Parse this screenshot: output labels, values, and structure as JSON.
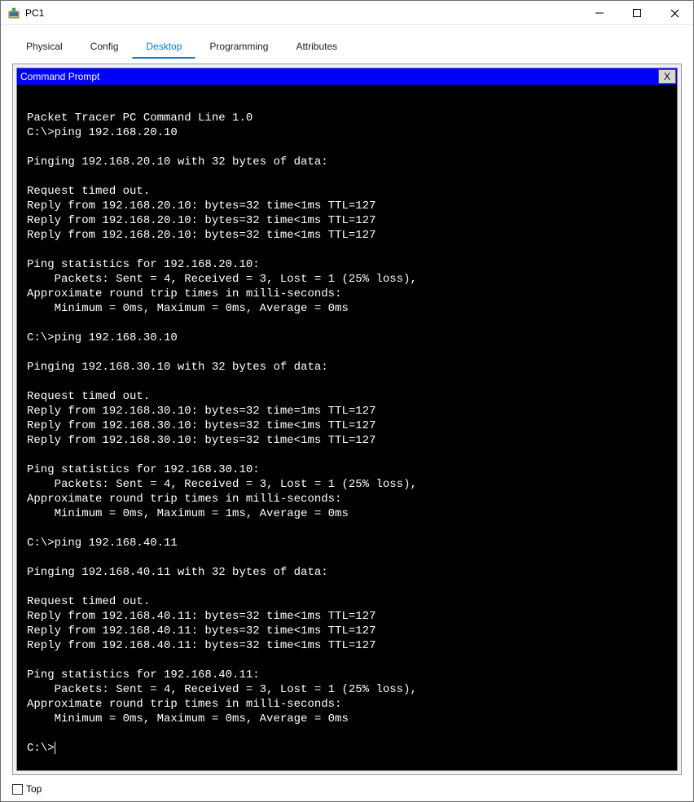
{
  "window": {
    "title": "PC1"
  },
  "tabs": {
    "items": [
      {
        "label": "Physical",
        "active": false
      },
      {
        "label": "Config",
        "active": false
      },
      {
        "label": "Desktop",
        "active": true
      },
      {
        "label": "Programming",
        "active": false
      },
      {
        "label": "Attributes",
        "active": false
      }
    ]
  },
  "cmd": {
    "title": "Command Prompt",
    "close_label": "X"
  },
  "terminal": {
    "lines": [
      "",
      "Packet Tracer PC Command Line 1.0",
      "C:\\>ping 192.168.20.10",
      "",
      "Pinging 192.168.20.10 with 32 bytes of data:",
      "",
      "Request timed out.",
      "Reply from 192.168.20.10: bytes=32 time<1ms TTL=127",
      "Reply from 192.168.20.10: bytes=32 time<1ms TTL=127",
      "Reply from 192.168.20.10: bytes=32 time<1ms TTL=127",
      "",
      "Ping statistics for 192.168.20.10:",
      "    Packets: Sent = 4, Received = 3, Lost = 1 (25% loss),",
      "Approximate round trip times in milli-seconds:",
      "    Minimum = 0ms, Maximum = 0ms, Average = 0ms",
      "",
      "C:\\>ping 192.168.30.10",
      "",
      "Pinging 192.168.30.10 with 32 bytes of data:",
      "",
      "Request timed out.",
      "Reply from 192.168.30.10: bytes=32 time=1ms TTL=127",
      "Reply from 192.168.30.10: bytes=32 time<1ms TTL=127",
      "Reply from 192.168.30.10: bytes=32 time<1ms TTL=127",
      "",
      "Ping statistics for 192.168.30.10:",
      "    Packets: Sent = 4, Received = 3, Lost = 1 (25% loss),",
      "Approximate round trip times in milli-seconds:",
      "    Minimum = 0ms, Maximum = 1ms, Average = 0ms",
      "",
      "C:\\>ping 192.168.40.11",
      "",
      "Pinging 192.168.40.11 with 32 bytes of data:",
      "",
      "Request timed out.",
      "Reply from 192.168.40.11: bytes=32 time<1ms TTL=127",
      "Reply from 192.168.40.11: bytes=32 time<1ms TTL=127",
      "Reply from 192.168.40.11: bytes=32 time<1ms TTL=127",
      "",
      "Ping statistics for 192.168.40.11:",
      "    Packets: Sent = 4, Received = 3, Lost = 1 (25% loss),",
      "Approximate round trip times in milli-seconds:",
      "    Minimum = 0ms, Maximum = 0ms, Average = 0ms",
      "",
      "C:\\>"
    ]
  },
  "bottombar": {
    "top_label": "Top",
    "top_checked": false
  }
}
